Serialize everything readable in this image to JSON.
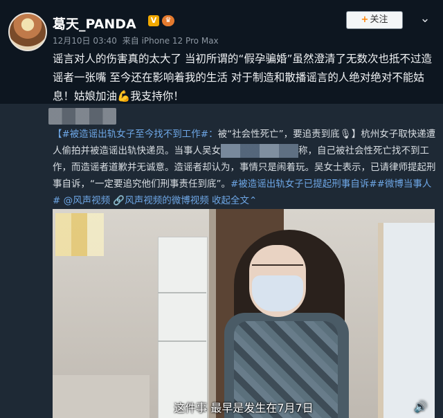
{
  "header": {
    "username": "葛天_PANDA",
    "vip_badge": "V",
    "level_badge": "♛",
    "timestamp": "12月10日 03:40",
    "source": "来自 iPhone 12 Pro Max",
    "follow_plus": "+",
    "follow_label": "关注",
    "more_icon": "⌄"
  },
  "post": {
    "text": "谣言对人的伤害真的太大了 当初所谓的“假孕骗婚”虽然澄清了无数次也抵不过造谣者一张嘴 至今还在影响着我的生活 对于制造和散播谣言的人绝对绝对不能姑息！姑娘加油💪我支持你！"
  },
  "repost": {
    "hashtag1": "【#被造谣出轨女子至今找不到工作#：",
    "segment1": "被“社会性死亡”，要追责到底🎙】杭州女子取快递遭人偷拍并被造谣出轨快递员。当事人吴女",
    "segment2": "称，自己被社会性死亡找不到工作，而造谣者道歉并无诚意。造谣者却认为，事情只是闹着玩。吴女士表示，已请律师提起刑事自诉，“一定要追究他们刑事责任到底”。",
    "hashtag2": "#被造谣出轨女子已提起刑事自诉##微博当事人#",
    "mention": " @风声视频",
    "video_link": " 🔗风声视频的微博视频",
    "collapse": " 收起全文",
    "collapse_icon": "⌃"
  },
  "video": {
    "subtitle": "这件事 最早是发生在7月7日",
    "volume_icon": "🔊"
  }
}
